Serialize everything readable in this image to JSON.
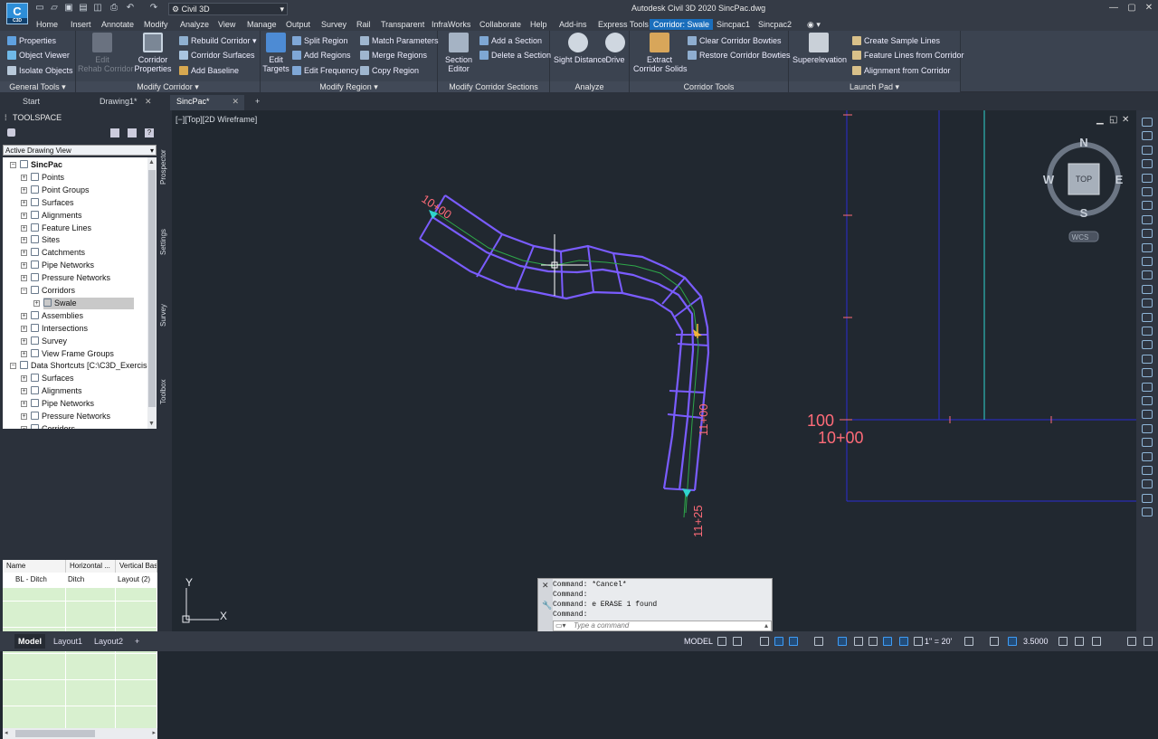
{
  "app": {
    "title": "Autodesk Civil 3D 2020  SincPac.dwg",
    "logo_text": "C",
    "logo_sub": "C3D",
    "workspace": "Civil 3D"
  },
  "ribbon_tabs": [
    "Home",
    "Insert",
    "Annotate",
    "Modify",
    "Analyze",
    "View",
    "Manage",
    "Output",
    "Survey",
    "Rail",
    "Transparent",
    "InfraWorks",
    "Collaborate",
    "Help",
    "Add-ins",
    "Express Tools",
    "Corridor: Swale",
    "Sincpac1",
    "Sincpac2"
  ],
  "ribbon_active_tab": "Corridor: Swale",
  "ribbon": {
    "general_tools": {
      "title": "General Tools",
      "properties": "Properties",
      "object_viewer": "Object Viewer",
      "isolate_objects": "Isolate Objects"
    },
    "modify_corridor": {
      "title": "Modify Corridor",
      "edit_rehab": "Edit\nRehab Corridor",
      "corridor_properties": "Corridor\nProperties",
      "rebuild": "Rebuild Corridor",
      "corridor_surfaces": "Corridor Surfaces",
      "add_baseline": "Add Baseline"
    },
    "modify_region": {
      "title": "Modify Region",
      "edit_targets": "Edit\nTargets",
      "split_region": "Split Region",
      "add_regions": "Add Regions",
      "edit_frequency": "Edit Frequency",
      "match_parameters": "Match Parameters",
      "merge_regions": "Merge Regions",
      "copy_region": "Copy Region"
    },
    "modify_sections": {
      "title": "Modify Corridor Sections",
      "section_editor": "Section\nEditor",
      "add_section": "Add a Section",
      "delete_section": "Delete a Section"
    },
    "analyze": {
      "title": "Analyze",
      "sight_distance": "Sight Distance",
      "drive": "Drive"
    },
    "corridor_tools": {
      "title": "Corridor Tools",
      "extract_solids": "Extract\nCorridor Solids",
      "clear_bowties": "Clear Corridor Bowties",
      "restore_bowties": "Restore Corridor Bowties"
    },
    "launch_pad": {
      "title": "Launch Pad",
      "superelevation": "Superelevation",
      "create_sample_lines": "Create Sample Lines",
      "feature_lines": "Feature Lines from Corridor",
      "alignment_from_corridor": "Alignment from Corridor"
    }
  },
  "doc_tabs": [
    "Start",
    "Drawing1*",
    "SincPac*"
  ],
  "viewport_label": "[−][Top][2D Wireframe]",
  "toolspace": {
    "title": "TOOLSPACE",
    "dropdown": "Active Drawing View",
    "side_tabs": [
      "Prospector",
      "Settings",
      "Survey",
      "Toolbox"
    ],
    "tree": [
      {
        "label": "SincPac",
        "level": 0,
        "bold": true
      },
      {
        "label": "Points",
        "level": 1
      },
      {
        "label": "Point Groups",
        "level": 1
      },
      {
        "label": "Surfaces",
        "level": 1
      },
      {
        "label": "Alignments",
        "level": 1
      },
      {
        "label": "Feature Lines",
        "level": 1
      },
      {
        "label": "Sites",
        "level": 1
      },
      {
        "label": "Catchments",
        "level": 1
      },
      {
        "label": "Pipe Networks",
        "level": 1
      },
      {
        "label": "Pressure Networks",
        "level": 1
      },
      {
        "label": "Corridors",
        "level": 1
      },
      {
        "label": "Swale",
        "level": 2,
        "selected": true
      },
      {
        "label": "Assemblies",
        "level": 1
      },
      {
        "label": "Intersections",
        "level": 1
      },
      {
        "label": "Survey",
        "level": 1
      },
      {
        "label": "View Frame Groups",
        "level": 1
      },
      {
        "label": "Data Shortcuts [C:\\C3D_Exercise...",
        "level": 0
      },
      {
        "label": "Surfaces",
        "level": 1
      },
      {
        "label": "Alignments",
        "level": 1
      },
      {
        "label": "Pipe Networks",
        "level": 1
      },
      {
        "label": "Pressure Networks",
        "level": 1
      },
      {
        "label": "Corridors",
        "level": 1
      }
    ],
    "grid_headers": [
      "Name",
      "Horizontal ...",
      "Vertical Bas"
    ],
    "grid_rows": [
      [
        "BL - Ditch",
        "Ditch",
        "Layout (2)"
      ]
    ]
  },
  "drawing": {
    "station_start": "10+00",
    "station_mid": "11+00",
    "station_end": "11+25",
    "profile_elev": "100",
    "profile_station": "10+00",
    "viewcube": {
      "n": "N",
      "s": "S",
      "e": "E",
      "w": "W",
      "top": "TOP",
      "wcs": "WCS"
    },
    "ucs_x": "X",
    "ucs_y": "Y"
  },
  "command": {
    "history": [
      "Command: *Cancel*",
      "Command:",
      "Command: e ERASE 1 found",
      "Command:"
    ],
    "placeholder": "Type a command"
  },
  "status": {
    "layout_tabs": [
      "Model",
      "Layout1",
      "Layout2"
    ],
    "model": "MODEL",
    "scale": "1\" = 20'",
    "zoom": "3.5000"
  },
  "colors": {
    "corridor": "#7a5cff",
    "alignment": "#2ea84a",
    "station_label": "#ff6b78",
    "accent": "#1a6ebc",
    "profile_grid": "#2b2bd4",
    "cyan": "#2fd4cf"
  }
}
